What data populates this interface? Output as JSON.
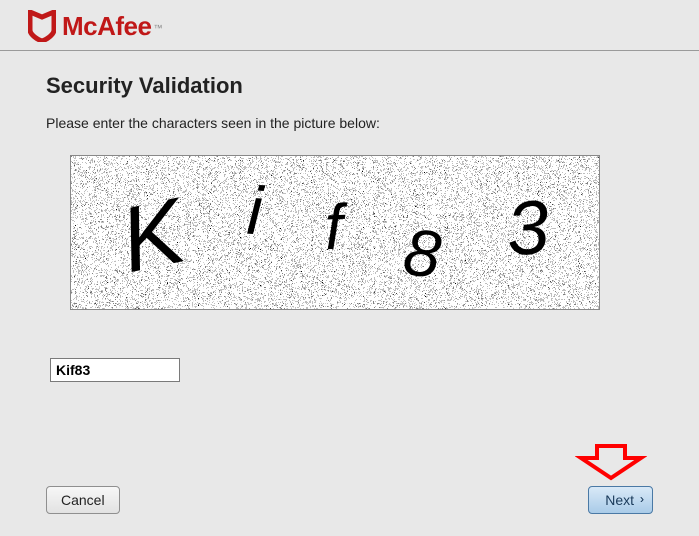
{
  "brand": {
    "name": "McAfee",
    "tm_symbol": "™",
    "color": "#c01818"
  },
  "page": {
    "title": "Security Validation",
    "instruction": "Please enter the characters seen in the picture below:"
  },
  "captcha": {
    "characters": "Kif83",
    "input_value": "Kif83"
  },
  "buttons": {
    "cancel": "Cancel",
    "next": "Next"
  },
  "annotation": {
    "arrow_color": "#ff0000",
    "points_to": "next-button"
  }
}
